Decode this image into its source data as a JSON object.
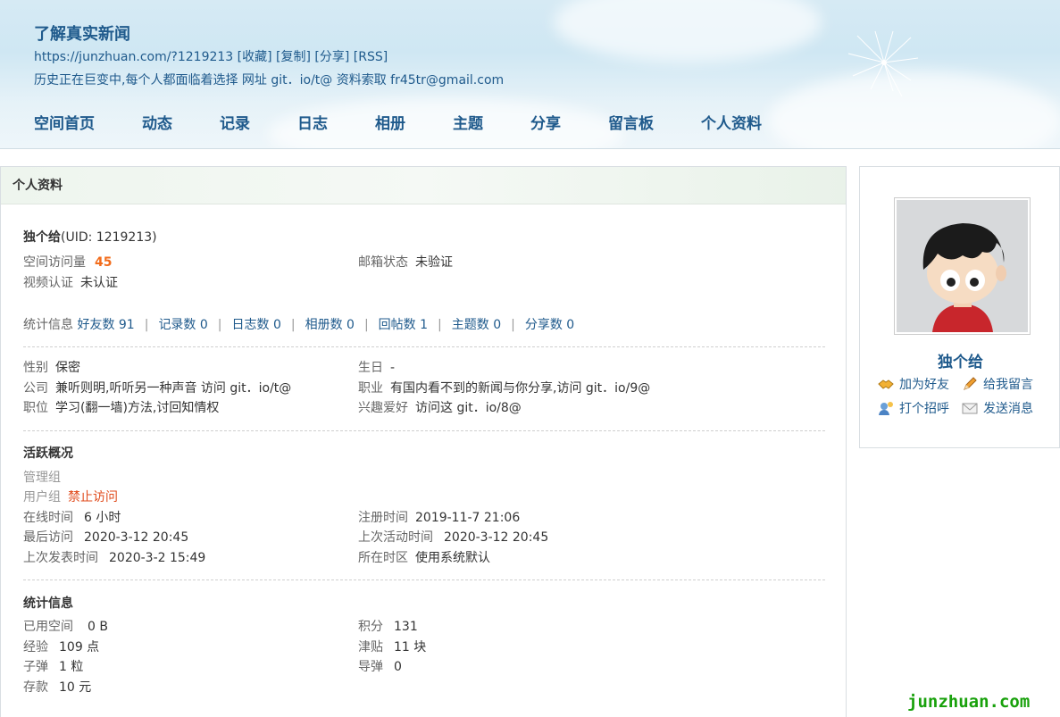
{
  "header": {
    "title": "了解真实新闻",
    "links": "https://junzhuan.com/?1219213 [收藏] [复制] [分享] [RSS]",
    "desc": "历史正在巨变中,每个人都面临着选择 网址 git．io/t@ 资料索取 fr45tr@gmail.com",
    "nav": [
      "空间首页",
      "动态",
      "记录",
      "日志",
      "相册",
      "主题",
      "分享",
      "留言板",
      "个人资料"
    ]
  },
  "panel": {
    "title": "个人资料",
    "username": "独个给",
    "uid": "(UID: 1219213)",
    "visits_label": "空间访问量",
    "visits": "45",
    "email_label": "邮箱状态",
    "email": "未验证",
    "video_label": "视频认证",
    "video": "未认证",
    "stats_label": "统计信息",
    "stats": [
      "好友数 91",
      "记录数 0",
      "日志数 0",
      "相册数 0",
      "回帖数 1",
      "主题数 0",
      "分享数 0"
    ],
    "gender_label": "性别",
    "gender": "保密",
    "birthday_label": "生日",
    "birthday": "-",
    "company_label": "公司",
    "company": "兼听则明,听听另一种声音 访问 git．io/t@",
    "job_label": "职业",
    "job": "有国内看不到的新闻与你分享,访问 git．io/9@",
    "position_label": "职位",
    "position": "学习(翻一墙)方法,讨回知情权",
    "hobby_label": "兴趣爱好",
    "hobby": "访问这 git．io/8@",
    "activity_title": "活跃概况",
    "admin_group": "管理组",
    "user_group_label": "用户组",
    "user_group": "禁止访问",
    "online_label": "在线时间",
    "online": "6 小时",
    "register_label": "注册时间",
    "register": "2019-11-7 21:06",
    "last_visit_label": "最后访问",
    "last_visit": "2020-3-12 20:45",
    "last_active_label": "上次活动时间",
    "last_active": "2020-3-12 20:45",
    "last_post_label": "上次发表时间",
    "last_post": "2020-3-2 15:49",
    "timezone_label": "所在时区",
    "timezone": "使用系统默认",
    "stats2_title": "统计信息",
    "space_label": "已用空间",
    "space": "0 B",
    "points_label": "积分",
    "points": "131",
    "exp_label": "经验",
    "exp": "109 点",
    "subsidy_label": "津贴",
    "subsidy": "11 块",
    "bullet_label": "子弹",
    "bullet": "1 粒",
    "missile_label": "导弹",
    "missile": "0",
    "deposit_label": "存款",
    "deposit": "10 元"
  },
  "side": {
    "name": "独个给",
    "add_friend": "加为好友",
    "leave_msg": "给我留言",
    "greet": "打个招呼",
    "send_msg": "发送消息"
  },
  "watermark": "junzhuan.com"
}
